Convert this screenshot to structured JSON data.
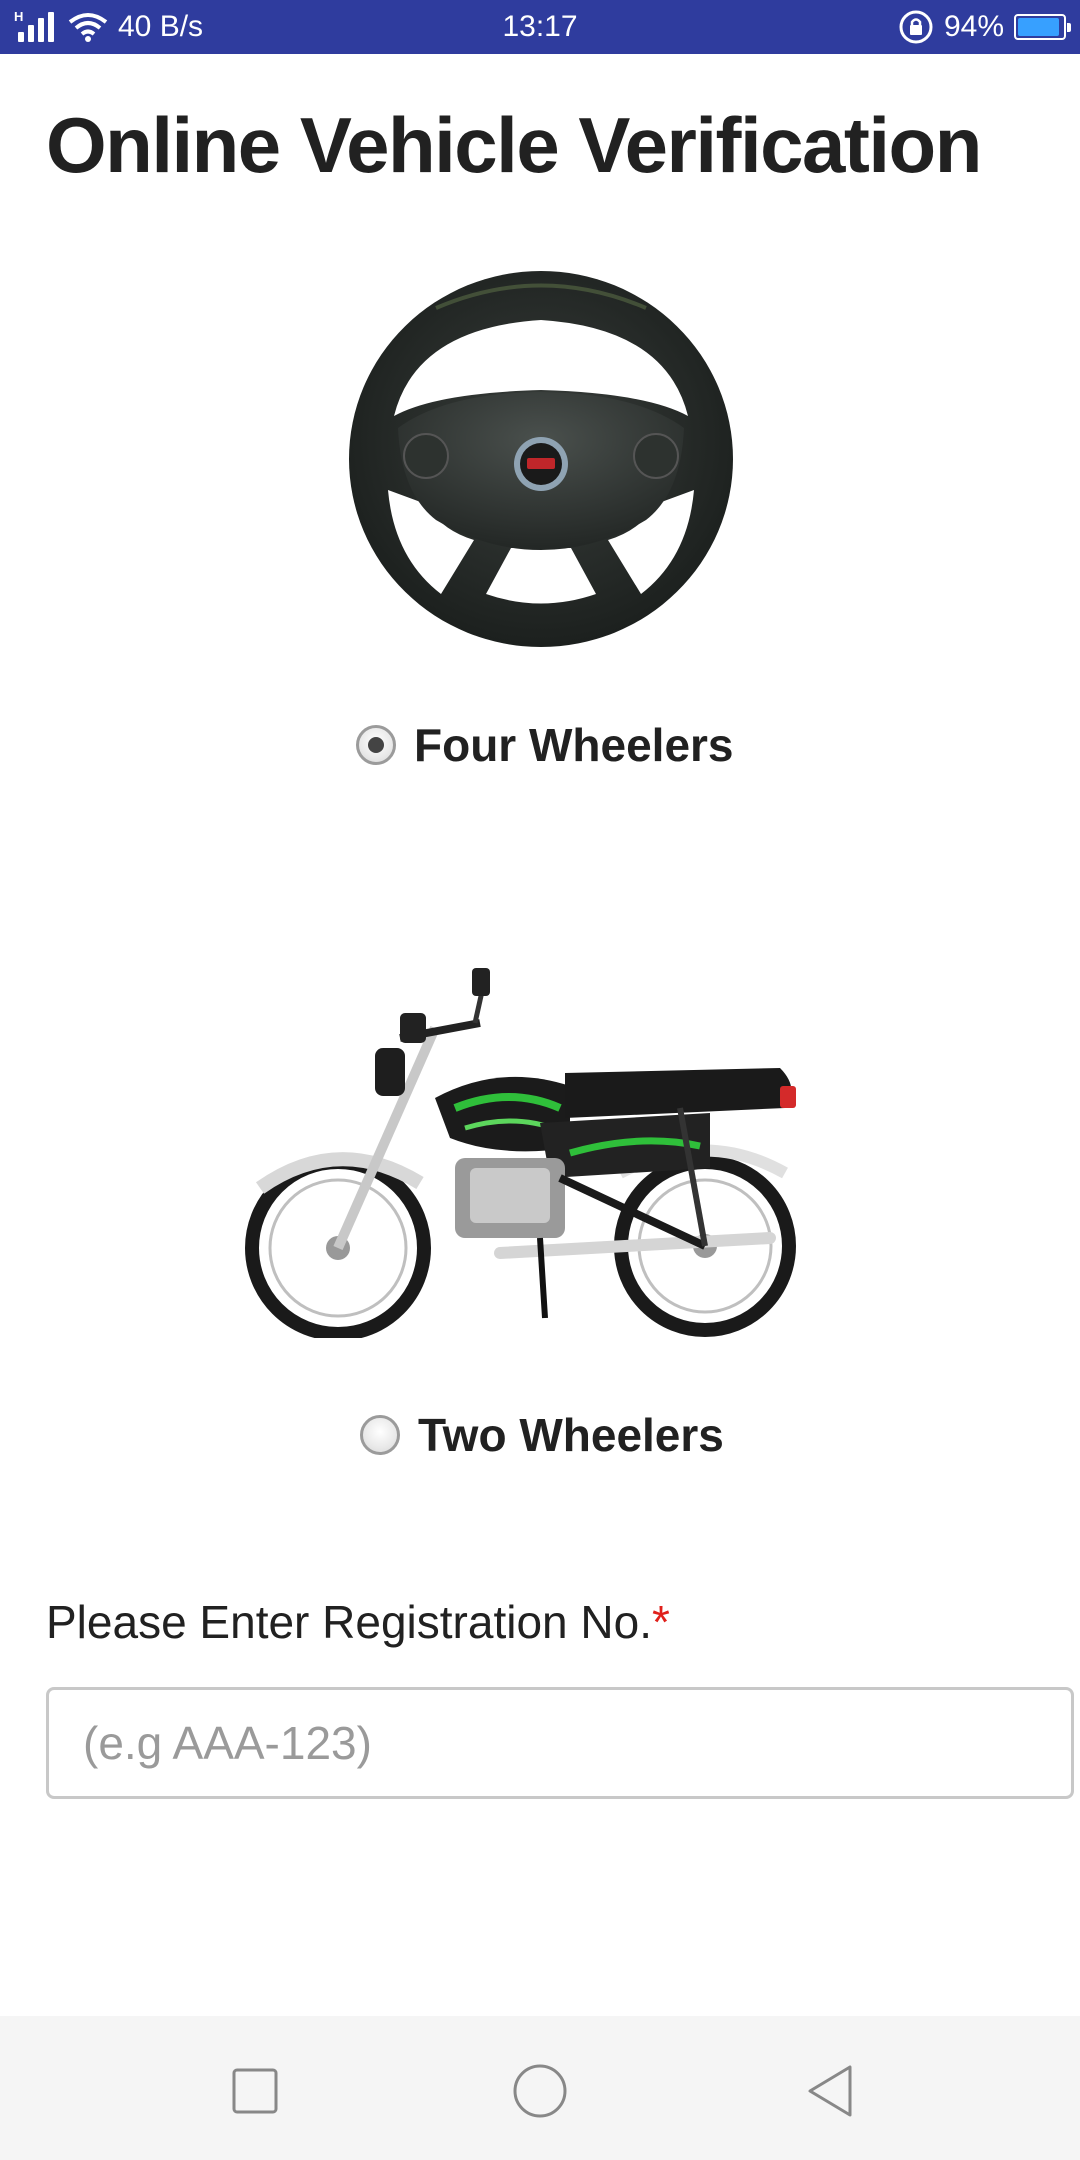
{
  "status_bar": {
    "network": "H",
    "speed": "40 B/s",
    "time": "13:17",
    "battery": "94%",
    "battery_level": 0.94
  },
  "page": {
    "title": "Online Vehicle Verification"
  },
  "vehicle_options": [
    {
      "label": "Four Wheelers",
      "selected": true,
      "icon": "steering-wheel-icon"
    },
    {
      "label": "Two Wheelers",
      "selected": false,
      "icon": "motorcycle-icon"
    }
  ],
  "registration": {
    "label": "Please Enter Registration No.",
    "required_mark": "*",
    "placeholder": "(e.g AAA-123)",
    "value": ""
  },
  "nav_bar": {
    "buttons": [
      "recent-apps",
      "home",
      "back"
    ]
  },
  "colors": {
    "status_bar_bg": "#2f3c9e",
    "required": "#e0201b",
    "bike_accent": "#2fbf3a"
  }
}
